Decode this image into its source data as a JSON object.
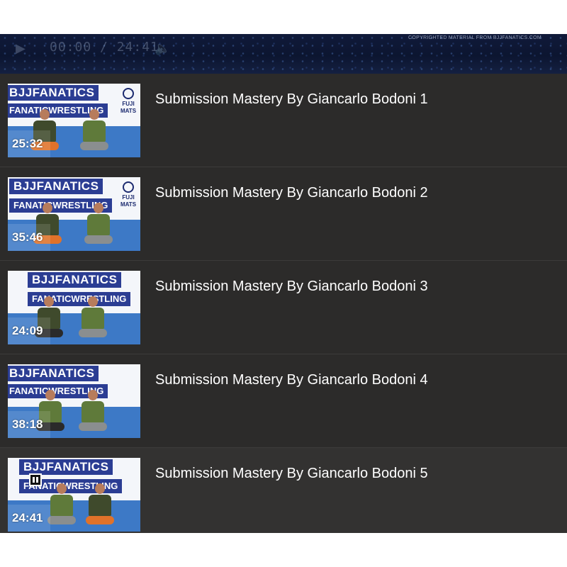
{
  "player": {
    "time": "00:00 / 24:41",
    "copyright": "COPYRIGHTED MATERIAL FROM BJJFANATICS.COM"
  },
  "thumbnail_text": {
    "brand": "BJJFANATICS",
    "sub": "FANATICWRESTLING",
    "logo": "FUJI MATS"
  },
  "playlist": {
    "items": [
      {
        "title": "Submission Mastery By Giancarlo Bodoni 1",
        "duration": "25:32"
      },
      {
        "title": "Submission Mastery By Giancarlo Bodoni 2",
        "duration": "35:46"
      },
      {
        "title": "Submission Mastery By Giancarlo Bodoni 3",
        "duration": "24:09"
      },
      {
        "title": "Submission Mastery By Giancarlo Bodoni 4",
        "duration": "38:18"
      },
      {
        "title": "Submission Mastery By Giancarlo Bodoni 5",
        "duration": "24:41"
      }
    ]
  },
  "colors": {
    "list_background": "#2c2b2a",
    "banner_blue": "#2b3d93",
    "mat_blue": "#3d79c6",
    "shirt_dark": "#3f4a2c",
    "shirt_green": "#5f7a3a",
    "shorts_orange": "#e0722a"
  },
  "icons": {
    "now_playing": "pause-icon"
  }
}
